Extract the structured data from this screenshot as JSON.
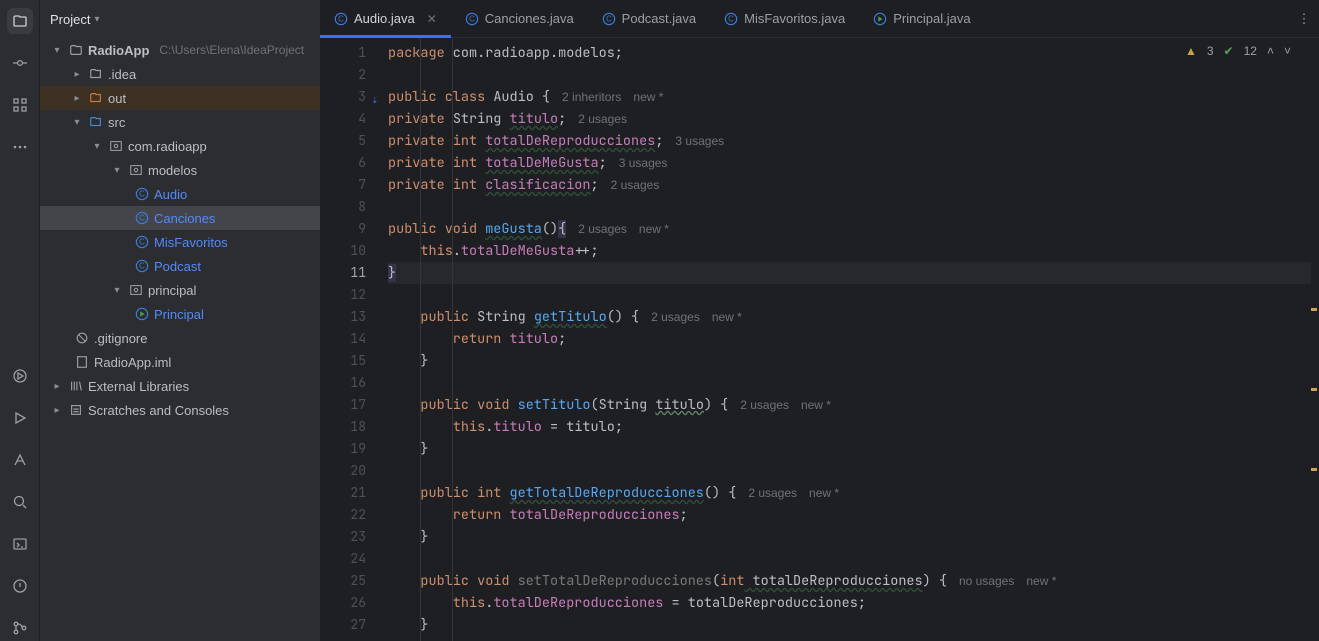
{
  "panel": {
    "title": "Project"
  },
  "tree": {
    "project": "RadioApp",
    "projectPath": "C:\\Users\\Elena\\IdeaProject",
    "idea": ".idea",
    "out": "out",
    "src": "src",
    "pkg1": "com.radioapp",
    "pkg2": "modelos",
    "cls0": "Audio",
    "cls1": "Canciones",
    "cls2": "MisFavoritos",
    "cls3": "Podcast",
    "pkg3": "principal",
    "cls4": "Principal",
    "gitignore": ".gitignore",
    "iml": "RadioApp.iml",
    "ext": "External Libraries",
    "scratches": "Scratches and Consoles"
  },
  "tabs": {
    "t0": "Audio.java",
    "t1": "Canciones.java",
    "t2": "Podcast.java",
    "t3": "MisFavoritos.java",
    "t4": "Principal.java"
  },
  "stats": {
    "warn": "3",
    "ok": "12"
  },
  "code": {
    "l1a": "package",
    "l1b": " com.radioapp.modelos;",
    "l3a": "public class ",
    "l3b": "Audio",
    "l3c": " {",
    "l3h1": "2 inheritors",
    "l3h2": "new *",
    "l4a": "private ",
    "l4b": "String ",
    "l4c": "titulo",
    "l4d": ";",
    "l4h": "2 usages",
    "l5a": "private int ",
    "l5b": "totalDeReproducciones",
    "l5c": ";",
    "l5h": "3 usages",
    "l6a": "private int ",
    "l6b": "totalDeMeGusta",
    "l6c": ";",
    "l6h": "3 usages",
    "l7a": "private int ",
    "l7b": "clasificacion",
    "l7c": ";",
    "l7h": "2 usages",
    "l9a": "public void ",
    "l9b": "meGusta",
    "l9c": "()",
    "l9d": "{",
    "l9h1": "2 usages",
    "l9h2": "new *",
    "l10a": "    this",
    "l10b": ".",
    "l10c": "totalDeMeGusta",
    "l10d": "++;",
    "l11": "}",
    "l13a": "    public ",
    "l13b": "String ",
    "l13c": "getTitulo",
    "l13d": "() {",
    "l13h1": "2 usages",
    "l13h2": "new *",
    "l14a": "        return ",
    "l14b": "titulo",
    "l14c": ";",
    "l15": "    }",
    "l17a": "    public void ",
    "l17b": "setTitulo",
    "l17c": "(String ",
    "l17d": "titulo",
    "l17e": ") {",
    "l17h1": "2 usages",
    "l17h2": "new *",
    "l18a": "        this",
    "l18b": ".",
    "l18c": "titulo",
    "l18d": " = titulo;",
    "l19": "    }",
    "l21a": "    public int ",
    "l21b": "getTotalDeReproducciones",
    "l21c": "() {",
    "l21h1": "2 usages",
    "l21h2": "new *",
    "l22a": "        return ",
    "l22b": "totalDeReproducciones",
    "l22c": ";",
    "l23": "    }",
    "l25a": "    public void ",
    "l25b": "setTotalDeReproducciones",
    "l25c": "(",
    "l25d": "int",
    "l25e": " totalDeReproducciones",
    "l25f": ") {",
    "l25h1": "no usages",
    "l25h2": "new *",
    "l26a": "        this",
    "l26b": ".",
    "l26c": "totalDeReproducciones",
    "l26d": " = totalDeReproducciones;",
    "l27": "    }"
  },
  "lines": [
    "1",
    "2",
    "3",
    "4",
    "5",
    "6",
    "7",
    "8",
    "9",
    "10",
    "11",
    "12",
    "13",
    "14",
    "15",
    "16",
    "17",
    "18",
    "19",
    "20",
    "21",
    "22",
    "23",
    "24",
    "25",
    "26",
    "27"
  ]
}
